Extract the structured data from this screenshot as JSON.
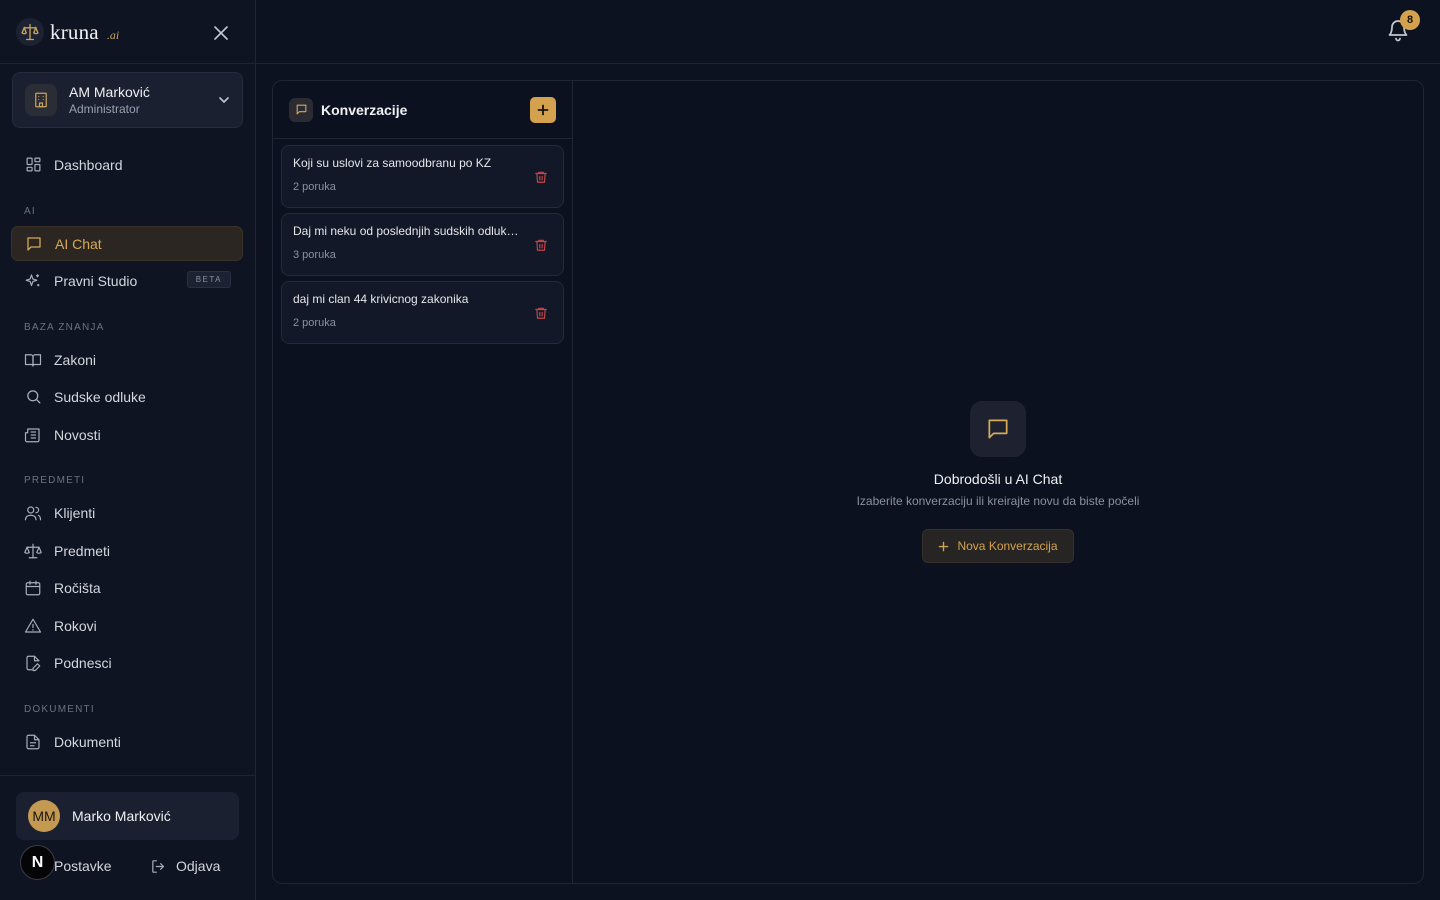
{
  "brand": {
    "name": "kruna",
    "suffix": ".ai"
  },
  "org": {
    "name": "AM Marković",
    "role": "Administrator"
  },
  "nav": {
    "dashboard": "Dashboard",
    "section_ai": "AI",
    "ai_chat": "AI Chat",
    "pravni_studio": "Pravni Studio",
    "beta": "BETA",
    "section_baza": "BAZA ZNANJA",
    "zakoni": "Zakoni",
    "sudske_odluke": "Sudske odluke",
    "novosti": "Novosti",
    "section_predmeti": "PREDMETI",
    "klijenti": "Klijenti",
    "predmeti": "Predmeti",
    "rocista": "Ročišta",
    "rokovi": "Rokovi",
    "podnesci": "Podnesci",
    "section_dokumenti": "DOKUMENTI",
    "dokumenti": "Dokumenti"
  },
  "user": {
    "initials": "MM",
    "name": "Marko Marković",
    "settings": "Postavke",
    "logout": "Odjava",
    "badge_letter": "N"
  },
  "notifications": {
    "count": "8"
  },
  "conversations": {
    "title": "Konverzacije",
    "items": [
      {
        "title": "Koji su uslovi za samoodbranu po KZ",
        "count": "2 poruka"
      },
      {
        "title": "Daj mi neku od poslednjih sudskih odluka i objasni je",
        "count": "3 poruka"
      },
      {
        "title": "daj mi clan 44 krivicnog zakonika",
        "count": "2 poruka"
      }
    ]
  },
  "welcome": {
    "title": "Dobrodošli u AI Chat",
    "subtitle": "Izaberite konverzaciju ili kreirajte novu da biste počeli",
    "button": "Nova Konverzacija"
  },
  "colors": {
    "accent": "#d4a24e",
    "background": "#0d1220",
    "danger": "#c0474a"
  }
}
